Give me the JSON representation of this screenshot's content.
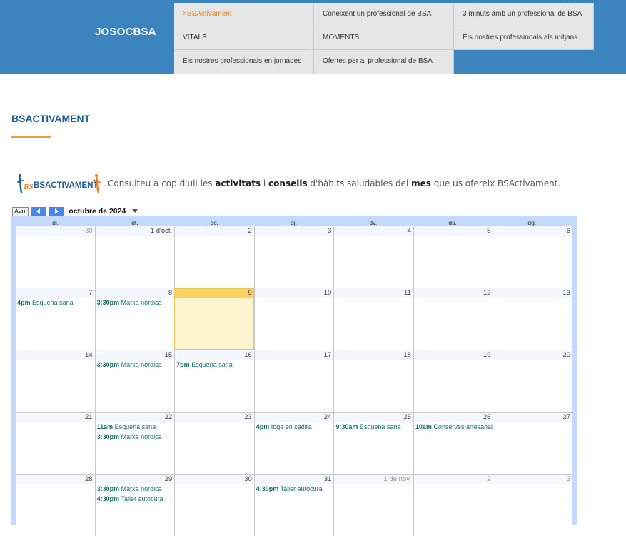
{
  "header": {
    "brand": "JOSOCBSA",
    "menu": [
      {
        "label": ">BSActivament",
        "active": true
      },
      {
        "label": "Coneixent un professional de BSA"
      },
      {
        "label": "3 minuts amb un professional de BSA"
      },
      {
        "label": "VITALS"
      },
      {
        "label": "MOMENTS"
      },
      {
        "label": "Els nostres professionals als mitjans"
      },
      {
        "label": "Els nostres professionals en jornades"
      },
      {
        "label": "Ofertes per al professional de BSA"
      }
    ]
  },
  "page": {
    "title": "BSACTIVAMENT",
    "logo_text": "BSACTIVAMENT",
    "intro": {
      "p1": "Consulteu a cop d'ull les ",
      "b1": "activitats",
      "p2": " i ",
      "b2": "consells",
      "p3": " d'hàbits saludables del ",
      "b3": "mes",
      "p4": " que us ofereix BSActivament."
    }
  },
  "calendar": {
    "today_button": "Avui",
    "prev_icon": "chevron-left-icon",
    "next_icon": "chevron-right-icon",
    "month_label": "octubre de 2024",
    "weekdays": [
      "dl.",
      "dt.",
      "dc.",
      "dj.",
      "dv.",
      "ds.",
      "dg."
    ],
    "colors": {
      "header_bg": "#c3d9ff",
      "today_bg": "#fff6d0",
      "today_header": "#fad163",
      "event_text": "#1b6e6e"
    },
    "weeks": [
      [
        {
          "d": "30",
          "other": true,
          "events": []
        },
        {
          "d": "1 d'oct.",
          "events": []
        },
        {
          "d": "2",
          "events": []
        },
        {
          "d": "3",
          "events": []
        },
        {
          "d": "4",
          "events": []
        },
        {
          "d": "5",
          "events": []
        },
        {
          "d": "6",
          "events": []
        }
      ],
      [
        {
          "d": "7",
          "events": [
            {
              "time": "4pm",
              "title": "Esquena sana"
            }
          ]
        },
        {
          "d": "8",
          "events": [
            {
              "time": "3:30pm",
              "title": "Marxa nòrdica"
            }
          ]
        },
        {
          "d": "9",
          "today": true,
          "events": []
        },
        {
          "d": "10",
          "events": []
        },
        {
          "d": "11",
          "events": []
        },
        {
          "d": "12",
          "events": []
        },
        {
          "d": "13",
          "events": []
        }
      ],
      [
        {
          "d": "14",
          "events": []
        },
        {
          "d": "15",
          "events": [
            {
              "time": "3:30pm",
              "title": "Marxa nòrdica"
            }
          ]
        },
        {
          "d": "16",
          "events": [
            {
              "time": "7pm",
              "title": "Esquena sana"
            }
          ]
        },
        {
          "d": "17",
          "events": []
        },
        {
          "d": "18",
          "events": []
        },
        {
          "d": "19",
          "events": []
        },
        {
          "d": "20",
          "events": []
        }
      ],
      [
        {
          "d": "21",
          "events": []
        },
        {
          "d": "22",
          "events": [
            {
              "time": "11am",
              "title": "Esquena sana"
            },
            {
              "time": "3:30pm",
              "title": "Marxa nòrdica"
            }
          ]
        },
        {
          "d": "23",
          "events": []
        },
        {
          "d": "24",
          "events": [
            {
              "time": "4pm",
              "title": "Ioga en cadira"
            }
          ]
        },
        {
          "d": "25",
          "events": [
            {
              "time": "9:30am",
              "title": "Esquena sana"
            }
          ]
        },
        {
          "d": "26",
          "events": [
            {
              "time": "10am",
              "title": "Conserves artesanals"
            }
          ]
        },
        {
          "d": "27",
          "events": []
        }
      ],
      [
        {
          "d": "28",
          "events": []
        },
        {
          "d": "29",
          "events": [
            {
              "time": "3:30pm",
              "title": "Marxa nòrdica"
            },
            {
              "time": "4:30pm",
              "title": "Taller autocura"
            }
          ]
        },
        {
          "d": "30",
          "events": []
        },
        {
          "d": "31",
          "events": [
            {
              "time": "4:30pm",
              "title": "Taller autocura"
            }
          ]
        },
        {
          "d": "1 de nov.",
          "other": true,
          "events": []
        },
        {
          "d": "2",
          "other": true,
          "events": []
        },
        {
          "d": "3",
          "other": true,
          "events": []
        }
      ]
    ]
  }
}
